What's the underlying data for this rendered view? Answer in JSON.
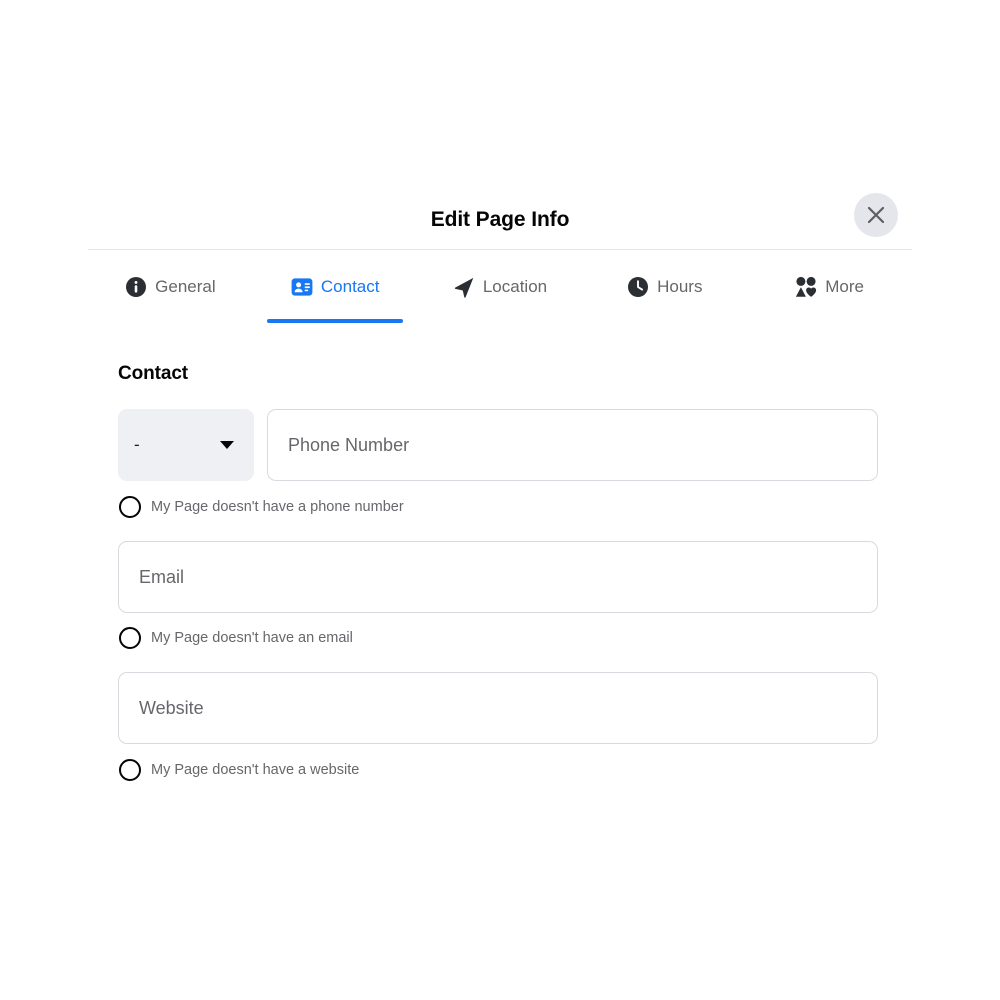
{
  "modal": {
    "title": "Edit Page Info",
    "close_label": "Close",
    "close_icon": "close-icon"
  },
  "tabs": [
    {
      "label": "General",
      "icon": "info-circle-icon",
      "active": false
    },
    {
      "label": "Contact",
      "icon": "contact-card-icon",
      "active": true
    },
    {
      "label": "Location",
      "icon": "navigation-arrow-icon",
      "active": false
    },
    {
      "label": "Hours",
      "icon": "clock-icon",
      "active": false
    },
    {
      "label": "More",
      "icon": "friends-icon",
      "active": false
    }
  ],
  "contact": {
    "section_title": "Contact",
    "country_code": {
      "value": "-",
      "caret_icon": "chevron-down-icon"
    },
    "phone": {
      "placeholder": "Phone Number",
      "value": "",
      "no_value_label": "My Page doesn't have a phone number"
    },
    "email": {
      "placeholder": "Email",
      "value": "",
      "no_value_label": "My Page doesn't have an email"
    },
    "website": {
      "placeholder": "Website",
      "value": "",
      "no_value_label": "My Page doesn't have a website"
    }
  },
  "colors": {
    "accent": "#1877F2",
    "text_primary": "#050505",
    "text_secondary": "#65676B",
    "border": "#D8DADF",
    "divider": "#E4E6EB",
    "field_bg": "#EEF0F4"
  }
}
